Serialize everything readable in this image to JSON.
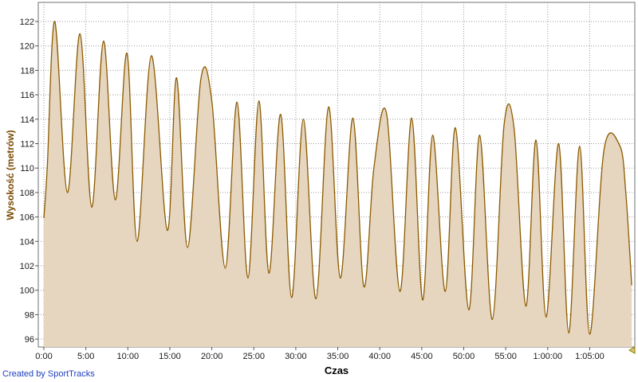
{
  "chart_data": {
    "type": "area",
    "title": "",
    "xlabel": "Czas",
    "ylabel": "Wysokość (metrów)",
    "xlim_minutes": [
      0,
      70
    ],
    "ylim": [
      95,
      123
    ],
    "grid": true,
    "x_ticks": [
      {
        "value": 0,
        "label": "0:00"
      },
      {
        "value": 5,
        "label": "5:00"
      },
      {
        "value": 10,
        "label": "10:00"
      },
      {
        "value": 15,
        "label": "15:00"
      },
      {
        "value": 20,
        "label": "20:00"
      },
      {
        "value": 25,
        "label": "25:00"
      },
      {
        "value": 30,
        "label": "30:00"
      },
      {
        "value": 35,
        "label": "35:00"
      },
      {
        "value": 40,
        "label": "40:00"
      },
      {
        "value": 45,
        "label": "45:00"
      },
      {
        "value": 50,
        "label": "50:00"
      },
      {
        "value": 55,
        "label": "55:00"
      },
      {
        "value": 60,
        "label": "1:00:00"
      },
      {
        "value": 65,
        "label": "1:05:00"
      }
    ],
    "y_ticks": [
      96,
      98,
      100,
      102,
      104,
      106,
      108,
      110,
      112,
      114,
      116,
      118,
      120,
      122
    ],
    "series": [
      {
        "x": [
          0.0,
          0.4,
          1.3,
          2.8,
          4.3,
          5.7,
          7.1,
          8.5,
          9.9,
          11.1,
          12.8,
          14.7,
          15.8,
          17.1,
          18.7,
          20.0,
          21.6,
          23.0,
          24.3,
          25.6,
          26.8,
          28.2,
          29.5,
          30.9,
          32.4,
          33.9,
          35.3,
          36.8,
          38.1,
          39.3,
          40.8,
          42.4,
          43.8,
          45.1,
          46.3,
          47.8,
          49.0,
          50.6,
          51.9,
          53.4,
          54.8,
          56.0,
          57.4,
          58.6,
          59.8,
          61.3,
          62.5,
          63.8,
          65.0,
          66.7,
          68.6,
          69.3,
          70.0
        ],
        "values": [
          105.9,
          110.0,
          122.0,
          108.0,
          121.0,
          106.8,
          120.4,
          107.4,
          119.4,
          104.0,
          119.2,
          104.9,
          117.4,
          103.5,
          117.3,
          115.5,
          101.8,
          115.4,
          101.0,
          115.5,
          101.4,
          114.4,
          99.4,
          114.0,
          99.3,
          115.0,
          101.0,
          114.1,
          100.3,
          110.0,
          114.5,
          99.9,
          114.1,
          99.2,
          112.7,
          99.9,
          113.3,
          98.4,
          112.7,
          97.6,
          113.5,
          113.2,
          98.7,
          112.3,
          97.8,
          112.0,
          96.5,
          111.8,
          96.4,
          111.5,
          111.8,
          108.0,
          100.4
        ]
      }
    ],
    "colors": {
      "fill": "#e6d6bf",
      "line": "#8b5a00",
      "plot_bg": "#ffffff",
      "grid": "#9a9a9a",
      "ylabel": "#7a4a00",
      "credit": "#1f3fbf"
    }
  },
  "footer": {
    "credit": "Created by SportTracks"
  }
}
